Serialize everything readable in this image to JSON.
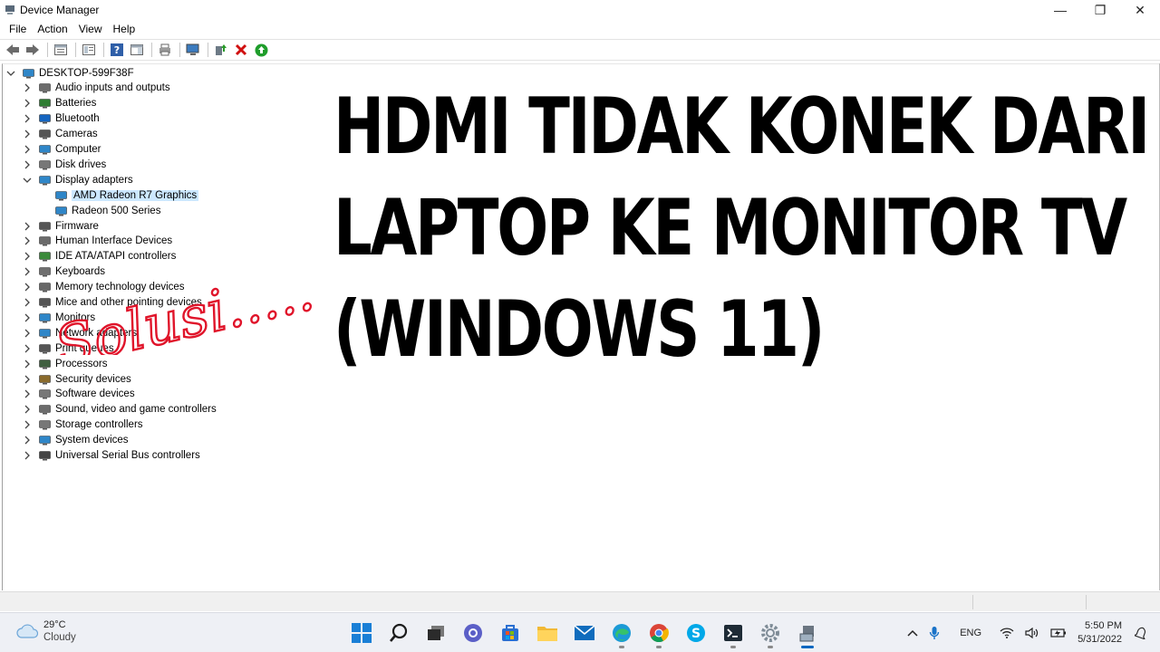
{
  "window": {
    "title": "Device Manager",
    "controls": {
      "minimize": "—",
      "restore": "❐",
      "close": "✕"
    }
  },
  "menu": [
    "File",
    "Action",
    "View",
    "Help"
  ],
  "toolbar": [
    "back-icon",
    "forward-icon",
    "properties-view-icon",
    "console-tree-icon",
    "help-icon",
    "action-pane-icon",
    "print-icon",
    "scan-hardware-icon",
    "update-driver-icon",
    "uninstall-device-icon",
    "enable-device-icon"
  ],
  "tree": {
    "root": "DESKTOP-599F38F",
    "categories": [
      {
        "label": "Audio inputs and outputs",
        "icon": "speaker-icon"
      },
      {
        "label": "Batteries",
        "icon": "battery-icon"
      },
      {
        "label": "Bluetooth",
        "icon": "bluetooth-icon"
      },
      {
        "label": "Cameras",
        "icon": "camera-icon"
      },
      {
        "label": "Computer",
        "icon": "computer-icon"
      },
      {
        "label": "Disk drives",
        "icon": "disk-icon"
      },
      {
        "label": "Display adapters",
        "icon": "display-adapter-icon",
        "expanded": true,
        "children": [
          {
            "label": "AMD Radeon R7 Graphics",
            "selected": true
          },
          {
            "label": "Radeon 500 Series"
          }
        ]
      },
      {
        "label": "Firmware",
        "icon": "chip-icon"
      },
      {
        "label": "Human Interface Devices",
        "icon": "hid-icon"
      },
      {
        "label": "IDE ATA/ATAPI controllers",
        "icon": "ide-icon"
      },
      {
        "label": "Keyboards",
        "icon": "keyboard-icon"
      },
      {
        "label": "Memory technology devices",
        "icon": "memory-icon"
      },
      {
        "label": "Mice and other pointing devices",
        "icon": "mouse-icon"
      },
      {
        "label": "Monitors",
        "icon": "monitor-icon"
      },
      {
        "label": "Network adapters",
        "icon": "network-icon"
      },
      {
        "label": "Print queues",
        "icon": "printer-icon"
      },
      {
        "label": "Processors",
        "icon": "processor-icon"
      },
      {
        "label": "Security devices",
        "icon": "security-icon"
      },
      {
        "label": "Software devices",
        "icon": "software-icon"
      },
      {
        "label": "Sound, video and game controllers",
        "icon": "sound-icon"
      },
      {
        "label": "Storage controllers",
        "icon": "storage-icon"
      },
      {
        "label": "System devices",
        "icon": "system-icon"
      },
      {
        "label": "Universal Serial Bus controllers",
        "icon": "usb-icon"
      }
    ]
  },
  "overlay": {
    "headline": [
      "HDMI TIDAK KONEK DARI",
      "LAPTOP KE MONITOR TV",
      "(WINDOWS 11)"
    ],
    "handwritten": "Solusi....."
  },
  "taskbar": {
    "weather_temp": "29°C",
    "weather_cond": "Cloudy",
    "apps": [
      "windows-start-icon",
      "search-icon",
      "task-view-icon",
      "teams-chat-icon",
      "store-icon",
      "file-explorer-icon",
      "mail-icon",
      "edge-icon",
      "chrome-icon",
      "skype-icon",
      "terminal-icon",
      "settings-icon",
      "device-manager-icon"
    ],
    "lang": "ENG",
    "time": "5:50 PM",
    "date": "5/31/2022"
  }
}
